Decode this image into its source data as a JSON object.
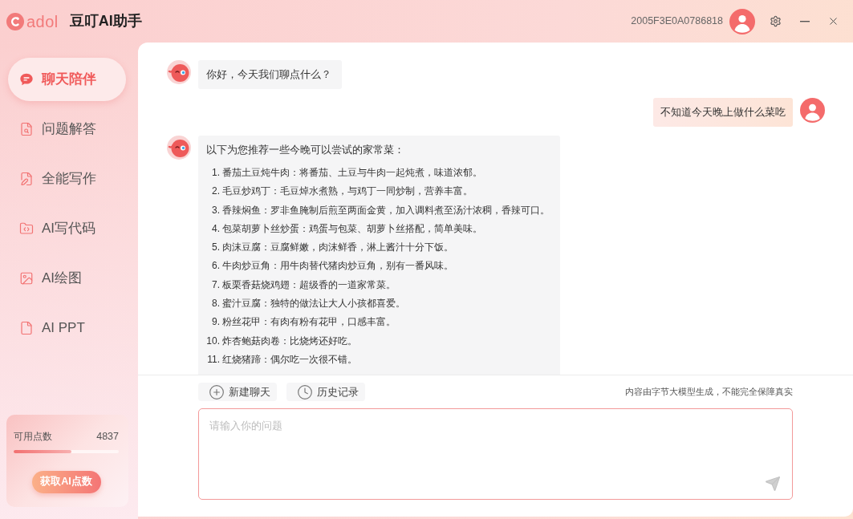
{
  "app": {
    "logo": "adol",
    "title": "豆叮AI助手"
  },
  "header": {
    "user_id": "2005F3E0A0786818"
  },
  "sidebar": {
    "items": [
      {
        "label": "聊天陪伴",
        "selected": true
      },
      {
        "label": "问题解答",
        "selected": false
      },
      {
        "label": "全能写作",
        "selected": false
      },
      {
        "label": "AI写代码",
        "selected": false
      },
      {
        "label": "AI绘图",
        "selected": false
      },
      {
        "label": "AI PPT",
        "selected": false
      }
    ]
  },
  "points": {
    "label": "可用点数",
    "value": "4837",
    "level": 0.55,
    "button": "获取AI点数"
  },
  "chat": {
    "messages": [
      {
        "kind": "assistant",
        "text": "你好，今天我们聊点什么？"
      },
      {
        "kind": "user",
        "text": "不知道今天晚上做什么菜吃"
      },
      {
        "kind": "assistant",
        "text": "以下为您推荐一些今晚可以尝试的家常菜：",
        "list": [
          {
            "number": "1.",
            "text": "番茄土豆炖牛肉：将番茄、土豆与牛肉一起炖煮，味道浓郁。"
          },
          {
            "number": "2.",
            "text": "毛豆炒鸡丁：毛豆焯水煮熟，与鸡丁一同炒制，营养丰富。"
          },
          {
            "number": "3.",
            "text": "香辣焖鱼：罗非鱼腌制后煎至两面金黄，加入调料煮至汤汁浓稠，香辣可口。"
          },
          {
            "number": "4.",
            "text": "包菜胡萝卜丝炒蛋：鸡蛋与包菜、胡萝卜丝搭配，简单美味。"
          },
          {
            "number": "5.",
            "text": "肉沫豆腐：豆腐鲜嫩，肉沫鲜香，淋上酱汁十分下饭。"
          },
          {
            "number": "6.",
            "text": "牛肉炒豆角：用牛肉替代猪肉炒豆角，别有一番风味。"
          },
          {
            "number": "7.",
            "text": "板栗香菇烧鸡翅：超级香的一道家常菜。"
          },
          {
            "number": "8.",
            "text": "蜜汁豆腐：独特的做法让大人小孩都喜爱。"
          },
          {
            "number": "9.",
            "text": "粉丝花甲：有肉有粉有花甲，口感丰富。"
          },
          {
            "number": "10.",
            "text": "炸杏鲍菇肉卷：比烧烤还好吃。"
          },
          {
            "number": "11.",
            "text": "红烧猪蹄：偶尔吃一次很不错。"
          }
        ]
      }
    ]
  },
  "toolbar": {
    "actions": [
      {
        "label": "新建聊天"
      },
      {
        "label": "历史记录"
      }
    ],
    "disclaimer": "内容由字节大模型生成，不能完全保障真实"
  },
  "input": {
    "placeholder": "请输入你的问题"
  }
}
